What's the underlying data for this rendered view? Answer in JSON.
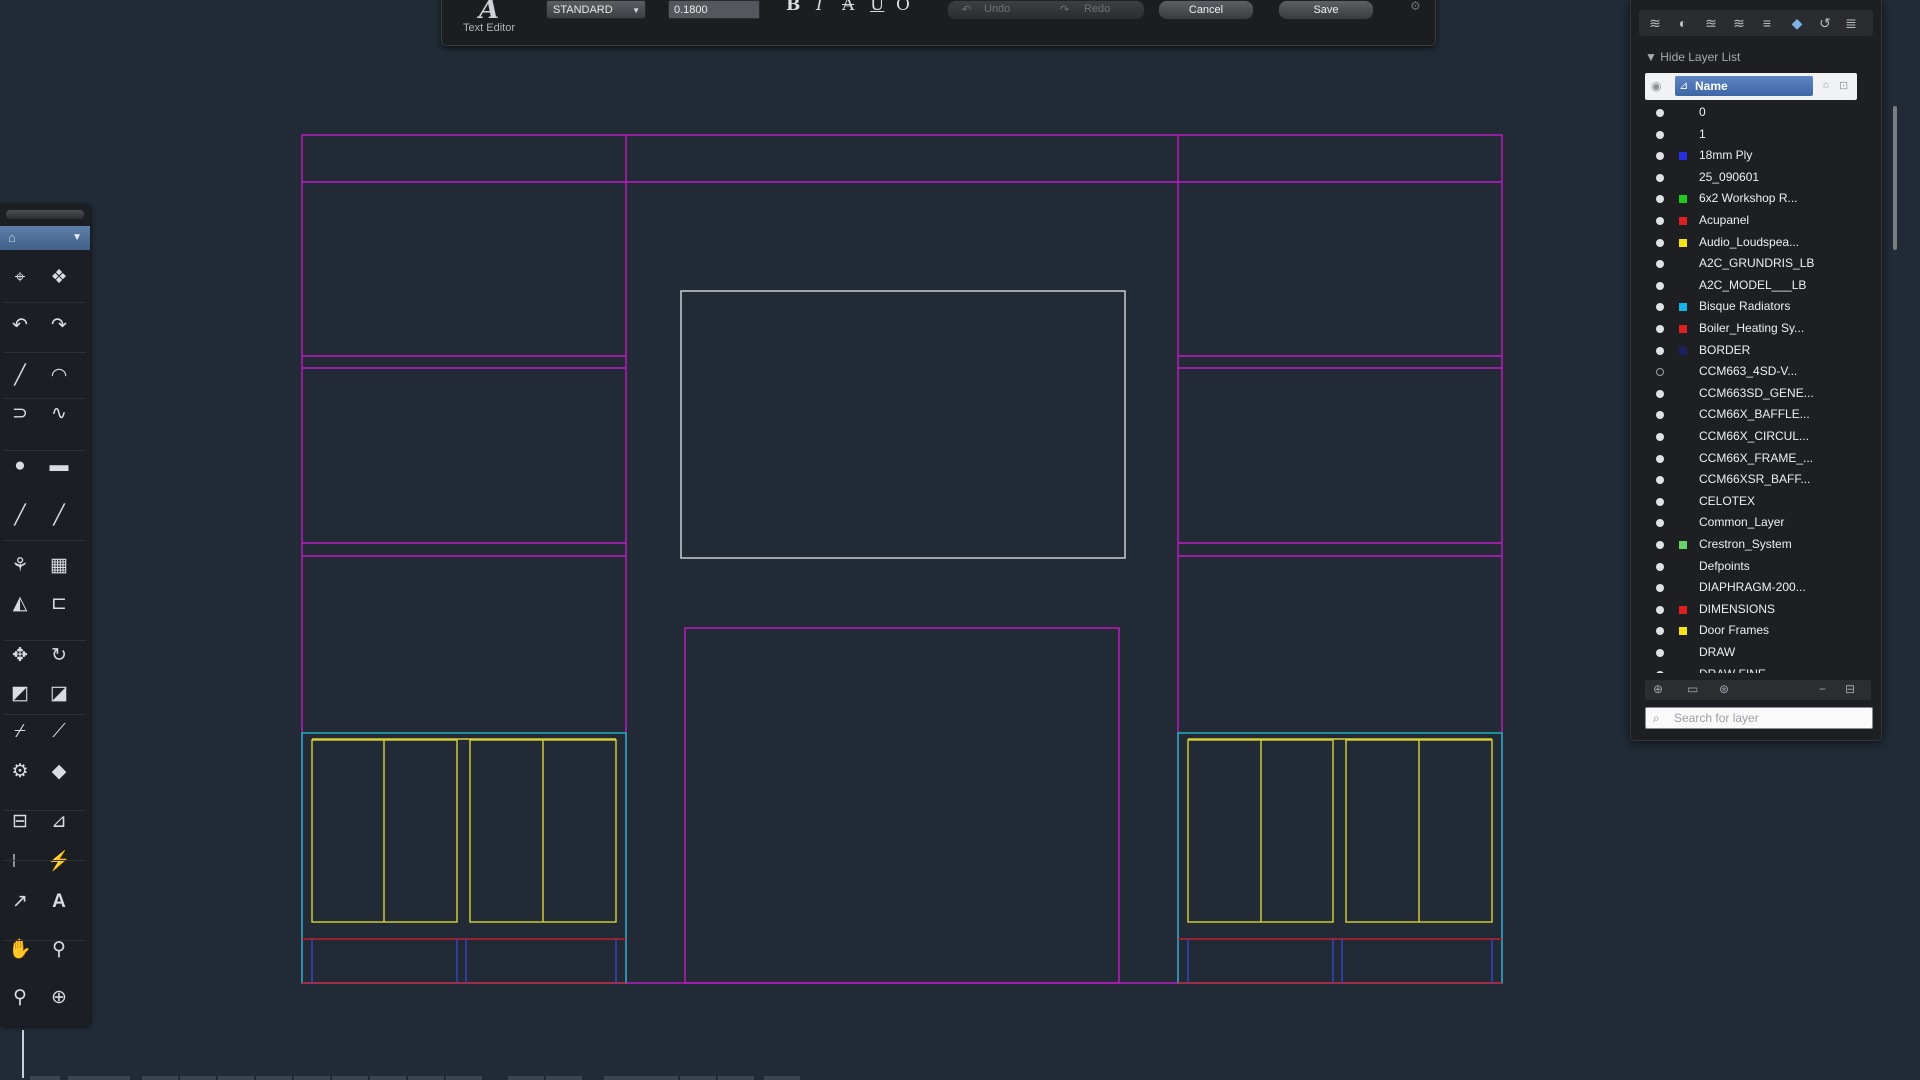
{
  "text_editor": {
    "title": "Text Editor",
    "logo_glyph": "A",
    "style": "STANDARD",
    "height": "0.1800",
    "format_buttons": [
      "B",
      "I",
      "A",
      "U",
      "O"
    ],
    "undo": "Undo",
    "redo": "Redo",
    "cancel": "Cancel",
    "save": "Save"
  },
  "tools": {
    "icons": [
      "point-icon",
      "cube-icon",
      "undo-icon",
      "redo-icon",
      "line-icon",
      "arc-icon",
      "polyline-icon",
      "spline-icon",
      "circle-icon",
      "rectangle-icon",
      "xline-icon",
      "ray-icon",
      "group-icon",
      "array-icon",
      "mirror-icon",
      "offset-icon",
      "move-icon",
      "rotate-icon",
      "scale-icon",
      "stretch-icon",
      "trim-icon",
      "extend-icon",
      "explode-icon",
      "erase-icon",
      "linear-dimension-icon",
      "angular-dimension-icon",
      "baseline-dimension-icon",
      "quick-dimension-icon",
      "leader-icon",
      "text-icon",
      "pan-icon",
      "zoom-realtime-icon",
      "zoom-icon",
      "zoom-extents-icon"
    ],
    "text_tool_label": "A"
  },
  "layers": {
    "hide_label": "Hide Layer List",
    "name_column": "Name",
    "search_placeholder": "Search for layer",
    "items": [
      {
        "name": "0",
        "color": "",
        "visible": true
      },
      {
        "name": "1",
        "color": "",
        "visible": true
      },
      {
        "name": "18mm Ply",
        "color": "#2430e0",
        "visible": true
      },
      {
        "name": "25_090601",
        "color": "",
        "visible": true
      },
      {
        "name": "6x2 Workshop R...",
        "color": "#1fc91f",
        "visible": true
      },
      {
        "name": "Acupanel",
        "color": "#e02020",
        "visible": true
      },
      {
        "name": "Audio_Loudspea...",
        "color": "#f2e419",
        "visible": true
      },
      {
        "name": "A2C_GRUNDRIS_LB",
        "color": "",
        "visible": true
      },
      {
        "name": "A2C_MODEL___LB",
        "color": "",
        "visible": true
      },
      {
        "name": "Bisque Radiators",
        "color": "#17b4e8",
        "visible": true
      },
      {
        "name": "Boiler_Heating Sy...",
        "color": "#e02020",
        "visible": true
      },
      {
        "name": "BORDER",
        "color": "#1a2260",
        "visible": true
      },
      {
        "name": "CCM663_4SD-V...",
        "color": "",
        "visible": false
      },
      {
        "name": "CCM663SD_GENE...",
        "color": "",
        "visible": true
      },
      {
        "name": "CCM66X_BAFFLE...",
        "color": "",
        "visible": true
      },
      {
        "name": "CCM66X_CIRCUL...",
        "color": "",
        "visible": true
      },
      {
        "name": "CCM66X_FRAME_...",
        "color": "",
        "visible": true
      },
      {
        "name": "CCM66XSR_BAFF...",
        "color": "",
        "visible": true
      },
      {
        "name": "CELOTEX",
        "color": "",
        "visible": true
      },
      {
        "name": "Common_Layer",
        "color": "",
        "visible": true
      },
      {
        "name": "Crestron_System",
        "color": "#6ad36a",
        "visible": true
      },
      {
        "name": "Defpoints",
        "color": "",
        "visible": true
      },
      {
        "name": "DIAPHRAGM-200...",
        "color": "",
        "visible": true
      },
      {
        "name": "DIMENSIONS",
        "color": "#e02020",
        "visible": true
      },
      {
        "name": "Door Frames",
        "color": "#f2e419",
        "visible": true
      },
      {
        "name": "DRAW",
        "color": "",
        "visible": true
      },
      {
        "name": "DRAW FINE",
        "color": "",
        "visible": true
      }
    ]
  },
  "colors": {
    "canvas": "#212a35",
    "magenta": "#c21ac8",
    "yellow": "#d8d23a",
    "cyan": "#1fb8c8",
    "red": "#c01f2c",
    "white": "#d7dade",
    "blue": "#3a44c8"
  }
}
